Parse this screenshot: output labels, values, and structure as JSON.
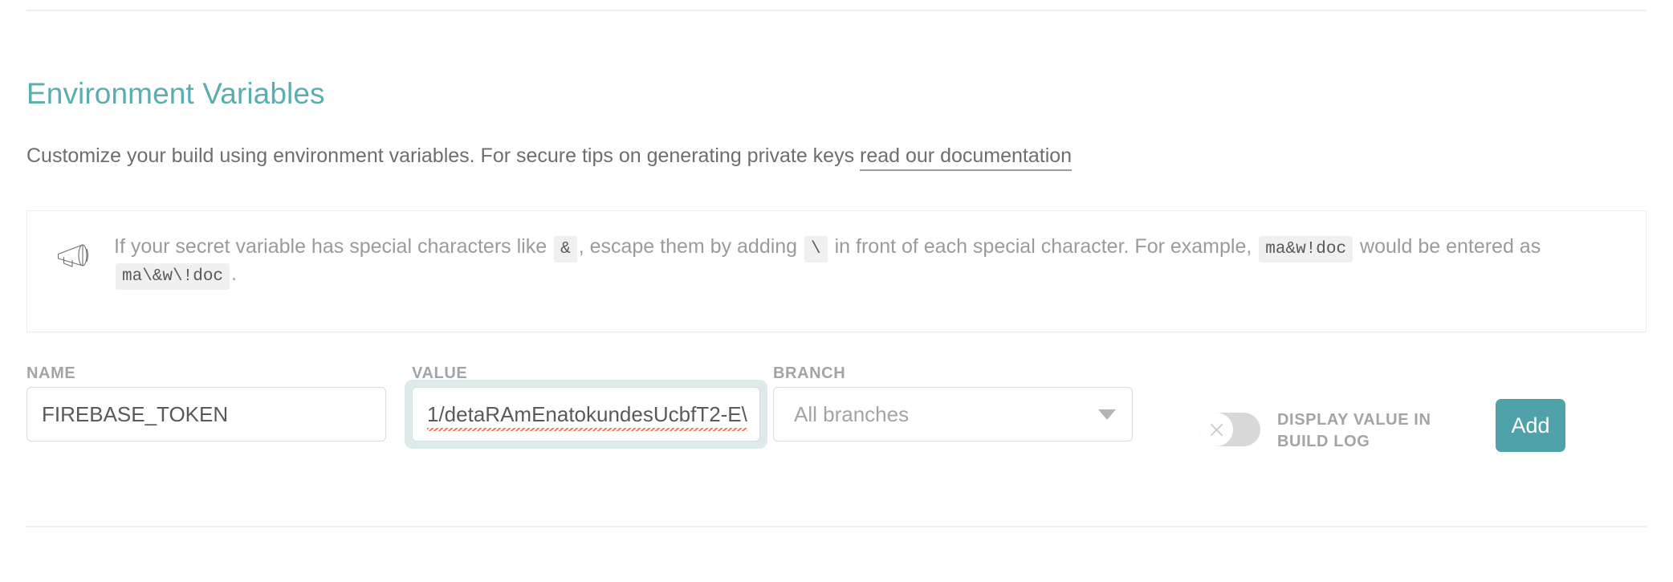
{
  "section": {
    "title": "Environment Variables",
    "description_before": "Customize your build using environment variables. For secure tips on generating private keys ",
    "doc_link": "read our documentation"
  },
  "tip": {
    "icon": "megaphone-icon",
    "part1": "If your secret variable has special characters like",
    "code_amp": "&",
    "part2": ", escape them by adding",
    "code_backslash": "\\",
    "part3": "in front of each special character. For example,",
    "code_example_raw": "ma&w!doc",
    "part4": "would be entered as",
    "code_example_escaped": "ma\\&w\\!doc",
    "part5": "."
  },
  "form": {
    "name": {
      "label": "NAME",
      "value": "FIREBASE_TOKEN",
      "placeholder": "NAME"
    },
    "value": {
      "label": "VALUE",
      "value": "1/detaRAmEnatokundesUcbfT2-E\\",
      "placeholder": "VALUE"
    },
    "branch": {
      "label": "BRANCH",
      "selected": "All branches",
      "options": [
        "All branches"
      ]
    },
    "display_toggle": {
      "label": "DISPLAY VALUE IN BUILD LOG",
      "state": "off"
    },
    "add_label": "Add"
  },
  "colors": {
    "accent_teal": "#4fa3a8",
    "heading_teal": "#5caeae",
    "text_gray": "#6d6e70",
    "muted_gray": "#a3a4a6",
    "focus_ring": "#dceaea",
    "spellcheck_red": "#f4735a",
    "divider": "#eeeeee"
  }
}
